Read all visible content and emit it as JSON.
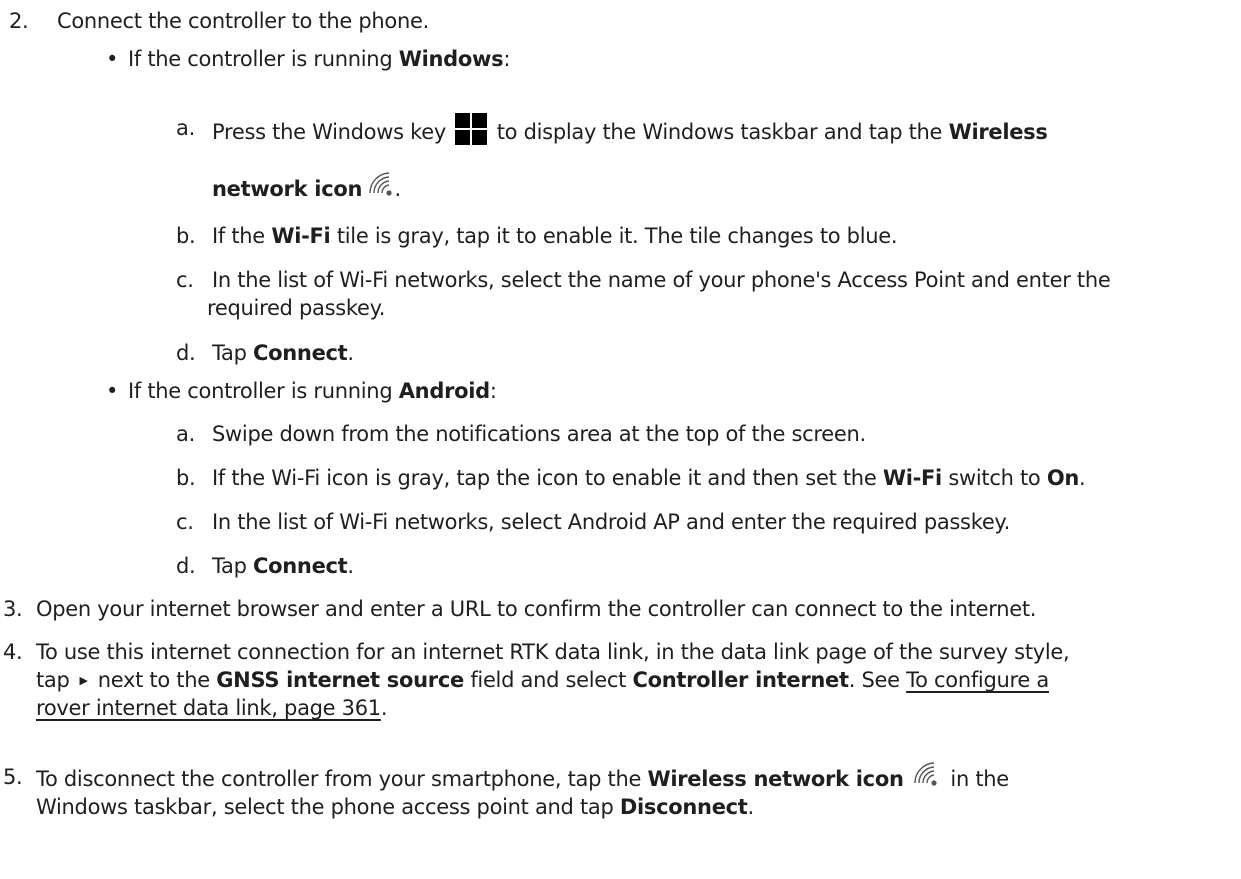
{
  "steps": {
    "s2": {
      "num": "2.",
      "text": "Connect the controller to the phone.",
      "windows": {
        "bullet_pre": "If the controller is running ",
        "bullet_bold": "Windows",
        "bullet_post": ":",
        "a": {
          "label": "a.",
          "t1": "Press the Windows key",
          "t2": "to display the Windows taskbar and tap the",
          "bold1": "Wireless",
          "bold2": "network icon",
          "t3": "."
        },
        "b": {
          "label": "b.",
          "t1": "If the",
          "bold": "Wi-Fi",
          "t2": "tile is gray, tap it to enable it. The tile changes to blue."
        },
        "c": {
          "label": "c.",
          "l1": "In the list of Wi-Fi networks, select the name of your phone's Access Point and enter the",
          "l2": "required passkey."
        },
        "d": {
          "label": "d.",
          "t1": "Tap",
          "bold": "Connect",
          "t2": "."
        }
      },
      "android": {
        "bullet_pre": "If the controller is running ",
        "bullet_bold": "Android",
        "bullet_post": ":",
        "a": {
          "label": "a.",
          "text": "Swipe down from the notifications area at the top of the screen."
        },
        "b": {
          "label": "b.",
          "t1": "If the Wi-Fi icon is gray, tap the icon to enable it and then set the",
          "bold1": "Wi-Fi",
          "t2": "switch to",
          "bold2": "On",
          "t3": "."
        },
        "c": {
          "label": "c.",
          "text": "In the list of Wi-Fi networks, select Android AP and enter the required passkey."
        },
        "d": {
          "label": "d.",
          "t1": "Tap",
          "bold": "Connect",
          "t2": "."
        }
      }
    },
    "s3": {
      "num": "3.",
      "text": "Open your internet browser and enter a URL to confirm the controller can connect to the internet."
    },
    "s4": {
      "num": "4.",
      "l1": "To use this internet connection for an internet RTK data link, in the data link page of the survey style,",
      "l2_tap": "tap",
      "l2_next": "next to the",
      "l2_bold1": "GNSS internet source",
      "l2_mid": "field and select",
      "l2_bold2": "Controller internet",
      "l2_see": ". See",
      "link_part1": "To configure a",
      "link_part2": "rover internet data link, page 361",
      "l3_end": "."
    },
    "s5": {
      "num": "5.",
      "t1": "To disconnect the controller from your smartphone, tap the",
      "bold1": "Wireless network icon",
      "t2": "in the",
      "l2_t1": "Windows taskbar, select the phone access point and tap",
      "bold2": "Disconnect",
      "l2_end": "."
    }
  }
}
